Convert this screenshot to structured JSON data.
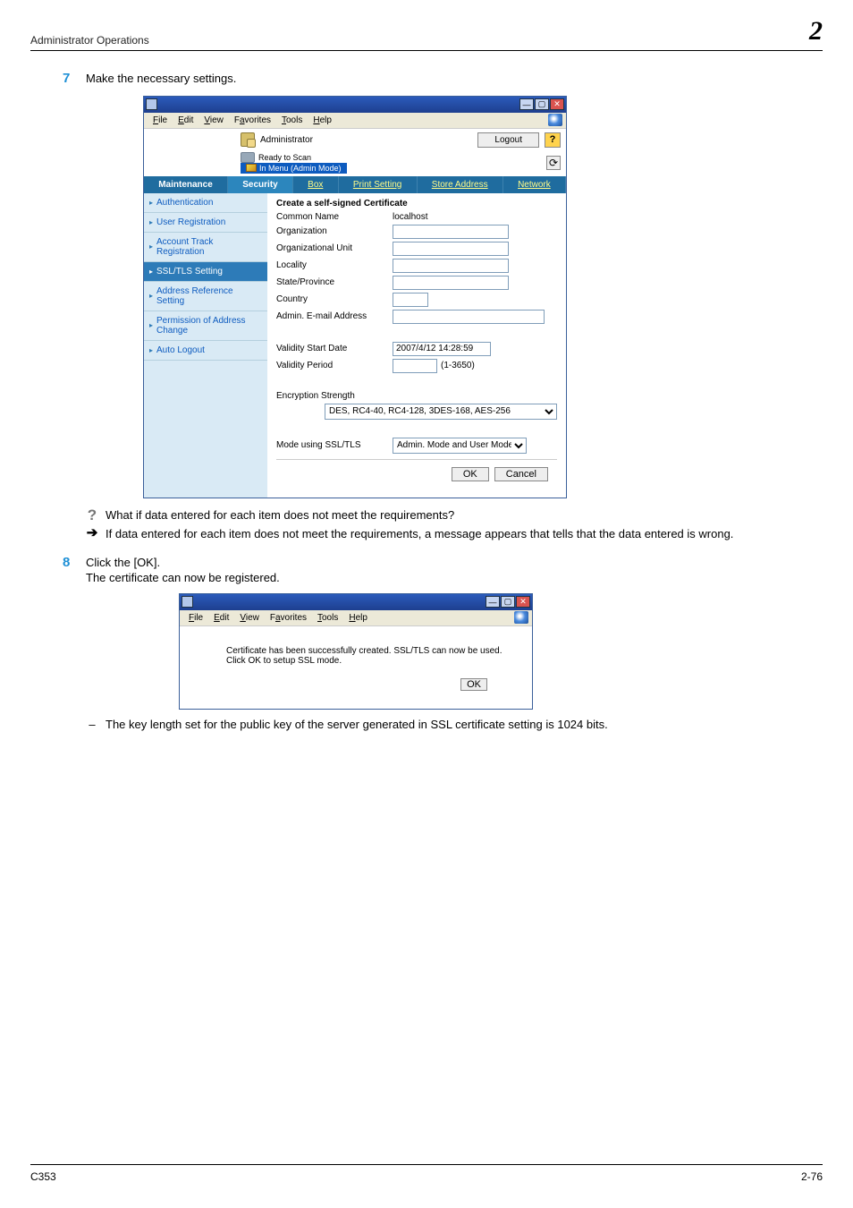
{
  "header": {
    "section": "Administrator Operations",
    "chapter": "2"
  },
  "steps": {
    "s7": {
      "num": "7",
      "text": "Make the necessary settings."
    },
    "s8": {
      "num": "8",
      "text": "Click the [OK].",
      "sub": "The certificate can now be registered."
    },
    "q": "What if data entered for each item does not meet the requirements?",
    "a": "If data entered for each item does not meet the requirements, a message appears that tells that the data entered is wrong.",
    "dash": "The key length set for the public key of the server generated in SSL certificate setting is 1024 bits."
  },
  "win_common": {
    "menu": [
      "File",
      "Edit",
      "View",
      "Favorites",
      "Tools",
      "Help"
    ]
  },
  "win1": {
    "admin_label": "Administrator",
    "logout": "Logout",
    "help": "?",
    "ready": "Ready to Scan",
    "in_menu": "In Menu (Admin Mode)",
    "refresh": "⟳",
    "tabs": [
      "Maintenance",
      "Security",
      "Box",
      "Print Setting",
      "Store Address",
      "Network"
    ],
    "sidebar": [
      "Authentication",
      "User Registration",
      "Account Track Registration",
      "SSL/TLS Setting",
      "Address Reference Setting",
      "Permission of Address Change",
      "Auto Logout"
    ],
    "form": {
      "title": "Create a self-signed Certificate",
      "common_name_l": "Common Name",
      "common_name_v": "localhost",
      "org_l": "Organization",
      "org_v": "",
      "ou_l": "Organizational Unit",
      "ou_v": "",
      "loc_l": "Locality",
      "loc_v": "",
      "state_l": "State/Province",
      "state_v": "",
      "country_l": "Country",
      "country_v": "",
      "email_l": "Admin. E-mail Address",
      "email_v": "",
      "start_l": "Validity Start Date",
      "start_v": "2007/4/12 14:28:59",
      "period_l": "Validity Period",
      "period_hint": "(1-3650)",
      "enc_l": "Encryption Strength",
      "enc_v": "DES, RC4-40, RC4-128, 3DES-168, AES-256",
      "mode_l": "Mode using SSL/TLS",
      "mode_v": "Admin. Mode and User Mode",
      "ok": "OK",
      "cancel": "Cancel"
    }
  },
  "win2": {
    "msg1": "Certificate has been successfully created. SSL/TLS can now be used.",
    "msg2": "Click OK to setup SSL mode.",
    "ok": "OK"
  },
  "footer": {
    "model": "C353",
    "page": "2-76"
  }
}
